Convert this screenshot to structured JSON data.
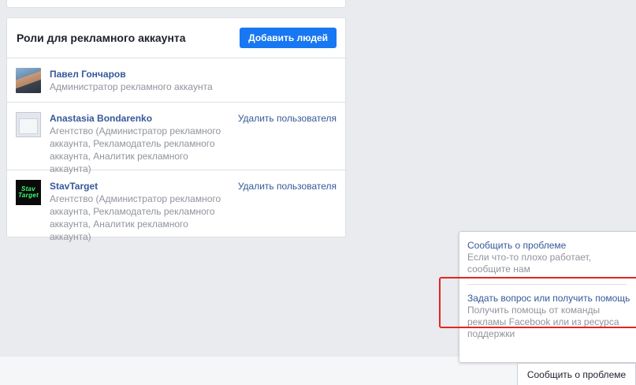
{
  "roles_card": {
    "title": "Роли для рекламного аккаунта",
    "add_people_label": "Добавить людей",
    "people": [
      {
        "name": "Павел Гончаров",
        "role": "Администратор рекламного аккаунта",
        "avatar": "user-photo"
      },
      {
        "name": "Anastasia Bondarenko",
        "role": "Агентство (Администратор рекламного аккаунта, Рекламодатель рекламного аккаунта, Аналитик рекламного аккаунта)",
        "avatar": "page-placeholder-icon",
        "remove_label": "Удалить пользователя"
      },
      {
        "name": "StavTarget",
        "role": "Агентство (Администратор рекламного аккаунта, Рекламодатель рекламного аккаунта, Аналитик рекламного аккаунта)",
        "avatar": "stavtarget-logo",
        "avatar_text": "Stav Target",
        "remove_label": "Удалить пользователя"
      }
    ]
  },
  "help_popup": {
    "items": [
      {
        "title": "Сообщить о проблеме",
        "description": "Если что-то плохо работает, сообщите нам"
      },
      {
        "title": "Задать вопрос или получить помощь",
        "description": "Получить помощь от команды рекламы Facebook или из ресурса поддержки"
      }
    ]
  },
  "report_tab_label": "Сообщить о проблеме",
  "colors": {
    "background": "#e9ebee",
    "accent": "#1877f2",
    "link": "#365899",
    "highlight": "#e52424"
  }
}
